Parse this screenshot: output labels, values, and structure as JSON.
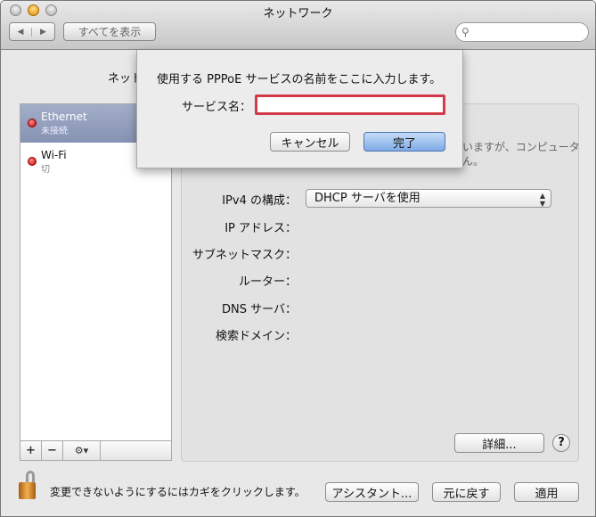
{
  "window": {
    "title": "ネットワーク"
  },
  "toolbar": {
    "back": "◀",
    "forward": "▶",
    "show_all": "すべてを表示",
    "search_placeholder": ""
  },
  "background_header": {
    "location_label_fragment": "ネットワ"
  },
  "services": [
    {
      "name": "Ethernet",
      "status": "未接続",
      "status_color": "#d00000",
      "selected": true
    },
    {
      "name": "Wi-Fi",
      "status": "切",
      "status_color": "#d00000",
      "selected": false
    }
  ],
  "list_bar": {
    "add": "+",
    "remove": "−",
    "gear": "⚙▾"
  },
  "panel": {
    "status_fragment": "いますが、コンピュータ",
    "status_fragment2": "ん。",
    "fields": [
      {
        "label": "IPv4 の構成："
      },
      {
        "label": "IP アドレス："
      },
      {
        "label": "サブネットマスク："
      },
      {
        "label": "ルーター："
      },
      {
        "label": "DNS サーバ："
      },
      {
        "label": "検索ドメイン："
      }
    ],
    "ipv4_value": "DHCP サーバを使用",
    "advanced": "詳細...",
    "help": "?"
  },
  "footer": {
    "lock_text": "変更できないようにするにはカギをクリックします。",
    "assistant": "アシスタント...",
    "revert": "元に戻す",
    "apply": "適用"
  },
  "dialog": {
    "message": "使用する PPPoE サービスの名前をここに入力します。",
    "field_label": "サービス名：",
    "field_value": "",
    "cancel": "キャンセル",
    "done": "完了"
  }
}
